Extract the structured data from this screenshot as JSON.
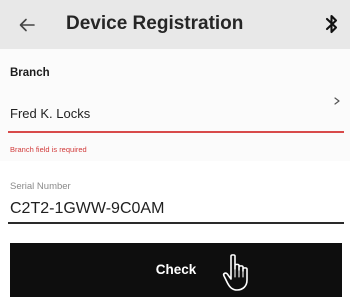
{
  "header": {
    "title": "Device Registration",
    "back_icon": "arrow-left-icon",
    "bluetooth_icon": "bluetooth-icon"
  },
  "branch": {
    "label": "Branch",
    "value": "Fred K. Locks",
    "chevron_icon": "chevron-right-icon",
    "error": "Branch field is required"
  },
  "serial": {
    "label": "Serial Number",
    "value": "C2T2-1GWW-9C0AM"
  },
  "actions": {
    "check_label": "Check",
    "cursor_icon": "hand-pointer-icon"
  },
  "colors": {
    "app_bar": "#e8e8e8",
    "error": "#d23b3b",
    "button": "#0e0e0e",
    "button_text": "#ffffff"
  }
}
